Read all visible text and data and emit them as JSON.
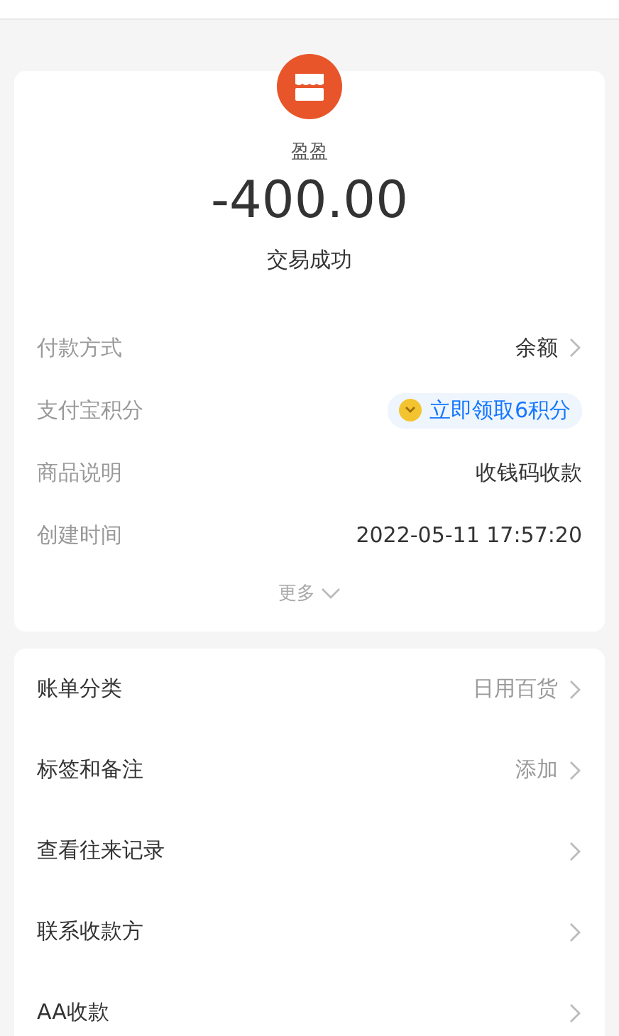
{
  "merchant": {
    "name": "盈盈",
    "amount": "-400.00",
    "status": "交易成功"
  },
  "details": [
    {
      "kind": "link",
      "label": "付款方式",
      "value": "余额"
    },
    {
      "kind": "badge",
      "label": "支付宝积分",
      "value": "立即领取6积分"
    },
    {
      "kind": "plain",
      "label": "商品说明",
      "value": "收钱码收款"
    },
    {
      "kind": "plain",
      "label": "创建时间",
      "value": "2022-05-11 17:57:20"
    }
  ],
  "more": {
    "label": "更多",
    "expanded": false
  },
  "actions": [
    {
      "label": "账单分类",
      "value": "日用百货"
    },
    {
      "label": "标签和备注",
      "value": "添加"
    },
    {
      "label": "查看往来记录"
    },
    {
      "label": "联系收款方"
    },
    {
      "label": "AA收款"
    }
  ]
}
